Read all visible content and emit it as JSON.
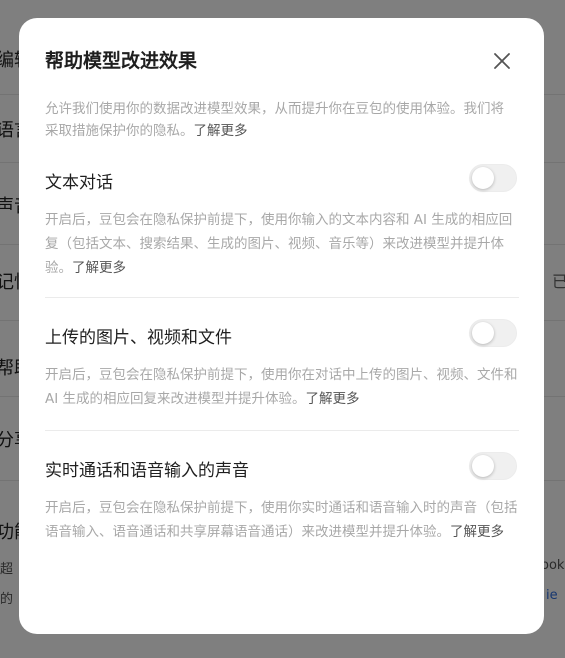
{
  "background": {
    "rows": [
      {
        "label": "编辑"
      },
      {
        "label": "语言"
      },
      {
        "label": "声音"
      },
      {
        "label": "记忆",
        "right": "已"
      },
      {
        "label": "帮助"
      },
      {
        "label": "分享"
      },
      {
        "label": "功能"
      }
    ],
    "footer_text_1": "超",
    "footer_text_2": "的",
    "footer_right_1": "ook",
    "footer_right_2": "ie"
  },
  "modal": {
    "title": "帮助模型改进效果",
    "intro_text": "允许我们使用你的数据改进模型效果，从而提升你在豆包的使用体验。我们将采取措施保护你的隐私。",
    "intro_link": "了解更多",
    "sections": [
      {
        "title": "文本对话",
        "enabled": false,
        "description": "开启后，豆包会在隐私保护前提下，使用你输入的文本内容和 AI 生成的相应回复（包括文本、搜索结果、生成的图片、视频、音乐等）来改进模型并提升体验。",
        "link": "了解更多"
      },
      {
        "title": "上传的图片、视频和文件",
        "enabled": false,
        "description": "开启后，豆包会在隐私保护前提下，使用你在对话中上传的图片、视频、文件和 AI 生成的相应回复来改进模型并提升体验。",
        "link": "了解更多"
      },
      {
        "title": "实时通话和语音输入的声音",
        "enabled": false,
        "description": "开启后，豆包会在隐私保护前提下，使用你实时通话和语音输入时的声音（包括语音输入、语音通话和共享屏幕语音通话）来改进模型并提升体验。",
        "link": "了解更多"
      }
    ]
  },
  "colors": {
    "overlay": "#000000",
    "title_text": "#1f1f1f",
    "muted_text": "#a8a8a8",
    "link_text": "#555555",
    "toggle_off": "#f0f0f0"
  },
  "icons": {
    "close": "close-icon"
  }
}
